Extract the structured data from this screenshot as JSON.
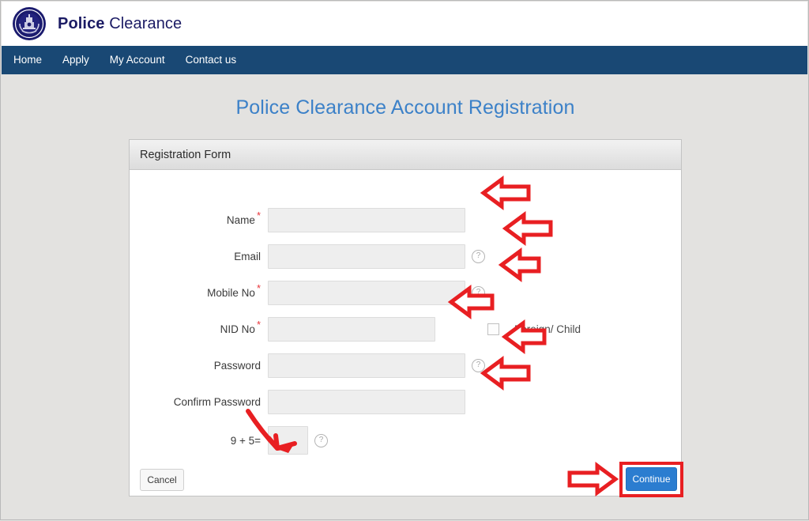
{
  "brand": {
    "logo_icon": "police-emblem-icon",
    "name_bold": "Police",
    "name_regular": " Clearance"
  },
  "nav": {
    "items": [
      {
        "label": "Home",
        "name": "nav-item-home"
      },
      {
        "label": "Apply",
        "name": "nav-item-apply"
      },
      {
        "label": "My Account",
        "name": "nav-item-my-account"
      },
      {
        "label": "Contact us",
        "name": "nav-item-contact-us"
      }
    ]
  },
  "page": {
    "title": "Police Clearance Account Registration"
  },
  "panel": {
    "title": "Registration Form"
  },
  "form": {
    "fields": [
      {
        "label": "Name",
        "required": true,
        "value": "",
        "placeholder": "",
        "help": false
      },
      {
        "label": "Email",
        "required": false,
        "value": "",
        "placeholder": "",
        "help": true,
        "help_icon": "question-mark-icon"
      },
      {
        "label": "Mobile No",
        "required": true,
        "value": "",
        "placeholder": "",
        "help": true,
        "help_icon": "question-mark-icon"
      },
      {
        "label": "NID No",
        "required": true,
        "value": "",
        "placeholder": "",
        "help": false
      },
      {
        "label": "Password",
        "required": false,
        "value": "",
        "placeholder": "",
        "help": true,
        "help_icon": "question-mark-icon"
      },
      {
        "label": "Confirm Password",
        "required": false,
        "value": "",
        "placeholder": "",
        "help": false
      }
    ],
    "foreign_child": {
      "label": "Foreign/ Child",
      "checked": false
    },
    "captcha": {
      "label": "9 + 5=",
      "value": "",
      "placeholder": "",
      "help_icon": "question-mark-icon"
    }
  },
  "footer": {
    "cancel_label": "Cancel",
    "continue_label": "Continue"
  },
  "annotations": {
    "arrow_color": "#e81f22",
    "arrows": [
      {
        "name": "annotation-arrow-name",
        "points_to": "Name"
      },
      {
        "name": "annotation-arrow-email",
        "points_to": "Email"
      },
      {
        "name": "annotation-arrow-mobile",
        "points_to": "Mobile No"
      },
      {
        "name": "annotation-arrow-nid",
        "points_to": "NID No"
      },
      {
        "name": "annotation-arrow-password",
        "points_to": "Password"
      },
      {
        "name": "annotation-arrow-confirm-password",
        "points_to": "Confirm Password"
      },
      {
        "name": "annotation-arrow-captcha",
        "points_to": "9 + 5="
      },
      {
        "name": "annotation-arrow-continue",
        "points_to": "Continue"
      }
    ],
    "highlight_box": {
      "name": "annotation-highlight-continue",
      "target": "Continue"
    }
  },
  "colors": {
    "navbar": "#194874",
    "brand_text": "#1b1b64",
    "page_title": "#3c81c8",
    "primary_button": "#2b7dd0",
    "required_asterisk": "#e8353a",
    "annotation_red": "#e81f22",
    "page_background": "#e3e2e0"
  }
}
